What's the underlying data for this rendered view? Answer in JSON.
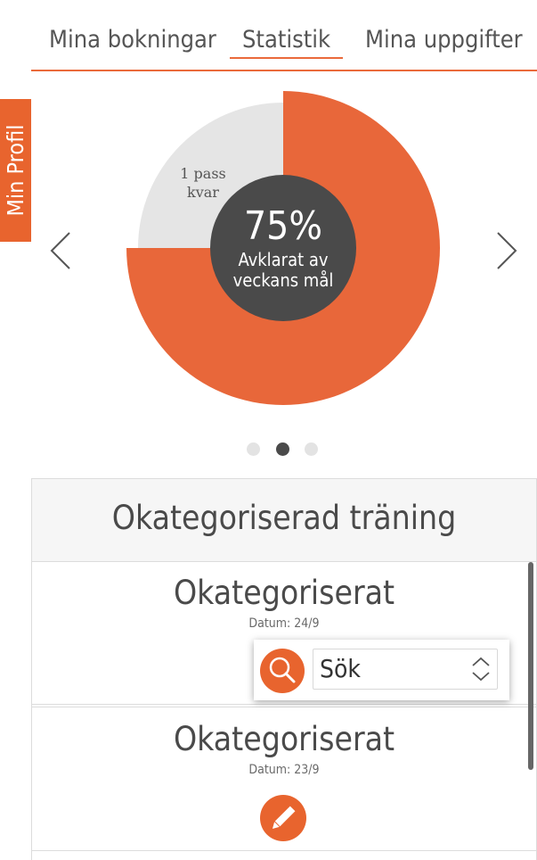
{
  "tabs": [
    {
      "label": "Mina bokningar",
      "active": false
    },
    {
      "label": "Statistik",
      "active": true
    },
    {
      "label": "Mina uppgifter",
      "active": false
    }
  ],
  "side_tab": {
    "label": "Min Profil"
  },
  "chart_data": {
    "type": "pie",
    "slices": [
      {
        "label": "Avklarat av veckans mål",
        "value": 75,
        "color": "#e8673a"
      },
      {
        "label": "1 pass kvar",
        "value": 25,
        "color": "#e5e5e5"
      }
    ],
    "center_value": "75%",
    "center_label_line1": "Avklarat av",
    "center_label_line2": "veckans mål",
    "remaining_line1": "1 pass",
    "remaining_line2": "kvar"
  },
  "carousel": {
    "pages": 3,
    "active_page": 2
  },
  "section": {
    "title": "Okategoriserad träning"
  },
  "entries": [
    {
      "title": "Okategoriserat",
      "date": "Datum: 24/9"
    },
    {
      "title": "Okategoriserat",
      "date": "Datum: 23/9"
    }
  ],
  "search": {
    "value": "Sök"
  },
  "colors": {
    "accent": "#e8642e",
    "dark": "#4a4a4a",
    "light": "#e5e5e5"
  },
  "icons": {
    "prev": "chevron-left-icon",
    "next": "chevron-right-icon",
    "search": "search-icon",
    "edit": "pencil-icon",
    "spinner": "up-down-chevron-icon"
  }
}
